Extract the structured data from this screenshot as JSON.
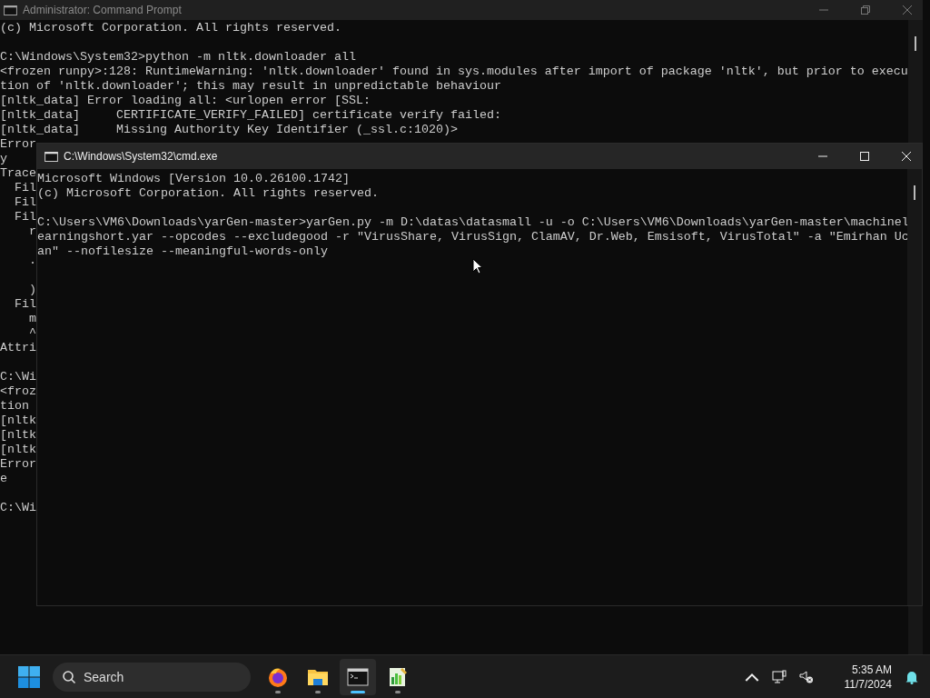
{
  "back_window": {
    "title": "Administrator: Command Prompt",
    "blocks": [
      [
        "(c) Microsoft Corporation. All rights reserved."
      ],
      [
        "C:\\Windows\\System32>python -m nltk.downloader all",
        "<frozen runpy>:128: RuntimeWarning: 'nltk.downloader' found in sys.modules after import of package 'nltk', but prior to execu",
        "tion of 'nltk.downloader'; this may result in unpredictable behaviour",
        "[nltk_data] Error loading all: <urlopen error [SSL:",
        "[nltk_data]     CERTIFICATE_VERIFY_FAILED] certificate verify failed:",
        "[nltk_data]     Missing Authority Key Identifier (_ssl.c:1020)>",
        "Error",
        "y",
        "Trace",
        "  Fil",
        "  Fil",
        "  Fil",
        "    r"
      ],
      [
        "    ."
      ],
      [
        "    )",
        "  Fil",
        "    m",
        "    ^",
        "Attri"
      ],
      [
        "C:\\Wi",
        "<froz",
        "tion",
        "[nltk",
        "[nltk",
        "[nltk",
        "Error",
        "e"
      ],
      [
        "C:\\Wi"
      ]
    ]
  },
  "front_window": {
    "title": "C:\\Windows\\System32\\cmd.exe",
    "blocks": [
      [
        "Microsoft Windows [Version 10.0.26100.1742]",
        "(c) Microsoft Corporation. All rights reserved."
      ],
      [
        "C:\\Users\\VM6\\Downloads\\yarGen-master>yarGen.py -m D:\\datas\\datasmall -u -o C:\\Users\\VM6\\Downloads\\yarGen-master\\machinel",
        "earningshort.yar --opcodes --excludegood -r \"VirusShare, VirusSign, ClamAV, Dr.Web, Emsisoft, VirusTotal\" -a \"Emirhan Uc",
        "an\" --nofilesize --meaningful-words-only"
      ]
    ]
  },
  "taskbar": {
    "search": {
      "placeholder": "Search"
    },
    "apps": [
      {
        "kind": "browser",
        "active": false
      },
      {
        "kind": "folder",
        "active": false
      },
      {
        "kind": "terminal",
        "active": true
      },
      {
        "kind": "editor",
        "active": false
      }
    ],
    "clock": {
      "time": "5:35 AM",
      "date": "11/7/2024"
    }
  }
}
